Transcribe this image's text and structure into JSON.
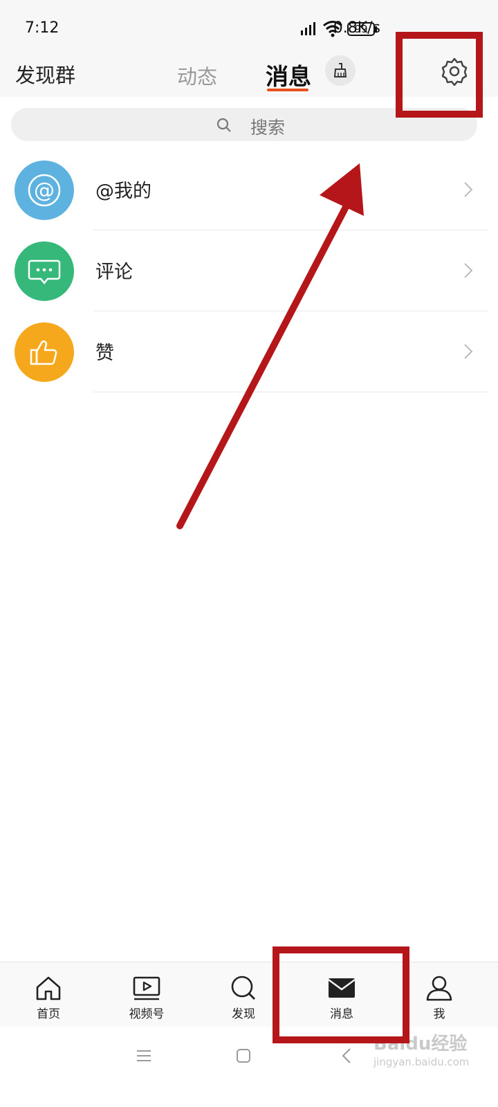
{
  "status": {
    "time": "7:12",
    "speed": "0.8K/s",
    "battery": "99"
  },
  "header": {
    "left_title": "发现群",
    "tabs": [
      {
        "label": "动态"
      },
      {
        "label": "消息"
      }
    ],
    "active_tab": "消息"
  },
  "search": {
    "placeholder": "搜索"
  },
  "messages": {
    "items": [
      {
        "label": "@我的",
        "icon": "at-icon",
        "color": "#5db2df"
      },
      {
        "label": "评论",
        "icon": "comment-icon",
        "color": "#36b87a"
      },
      {
        "label": "赞",
        "icon": "thumbs-up-icon",
        "color": "#f6a81d"
      }
    ]
  },
  "tabbar": {
    "items": [
      {
        "label": "首页",
        "icon": "home-icon"
      },
      {
        "label": "视频号",
        "icon": "video-icon"
      },
      {
        "label": "发现",
        "icon": "search-icon"
      },
      {
        "label": "消息",
        "icon": "mail-icon"
      },
      {
        "label": "我",
        "icon": "user-icon"
      }
    ]
  },
  "annotation_color": "#b5161a",
  "watermark": {
    "brand": "Baidu经验",
    "url": "jingyan.baidu.com"
  }
}
